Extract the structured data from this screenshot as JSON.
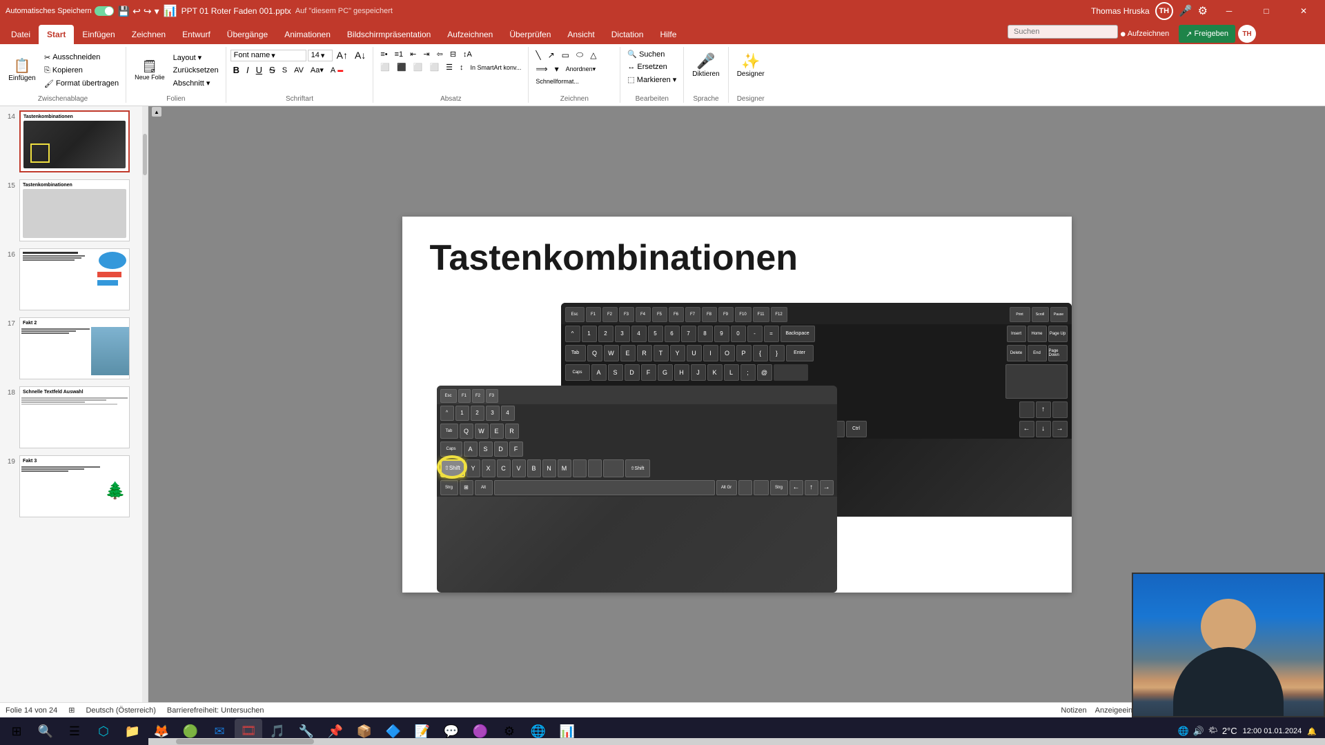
{
  "titlebar": {
    "autosave_label": "Automatisches Speichern",
    "autosave_on": true,
    "filename": "PPT 01 Roter Faden 001.pptx",
    "save_location": "Auf \"diesem PC\" gespeichert",
    "user_name": "Thomas Hruska",
    "user_initials": "TH",
    "minimize_btn": "─",
    "restore_btn": "□",
    "close_btn": "✕"
  },
  "ribbon": {
    "tabs": [
      {
        "label": "Datei",
        "active": false
      },
      {
        "label": "Start",
        "active": true
      },
      {
        "label": "Einfügen",
        "active": false
      },
      {
        "label": "Zeichnen",
        "active": false
      },
      {
        "label": "Entwurf",
        "active": false
      },
      {
        "label": "Übergänge",
        "active": false
      },
      {
        "label": "Animationen",
        "active": false
      },
      {
        "label": "Bildschirmpräsentation",
        "active": false
      },
      {
        "label": "Aufzeichnen",
        "active": false
      },
      {
        "label": "Überprüfen",
        "active": false
      },
      {
        "label": "Ansicht",
        "active": false
      },
      {
        "label": "Dictation",
        "active": false
      },
      {
        "label": "Hilfe",
        "active": false
      }
    ],
    "groups": {
      "zwischenablage": {
        "label": "Zwischenablage",
        "einfuegen": "Einfügen",
        "ausschneiden": "Ausschneiden",
        "kopieren": "Kopieren",
        "format_uebertragen": "Format übertragen"
      },
      "folien": {
        "label": "Folien",
        "neue_folie": "Neue\nFolie",
        "layout": "Layout",
        "zuruecksetzen": "Zurücksetzen",
        "abschnitt": "Abschnitt"
      },
      "schriftart": {
        "label": "Schriftart"
      },
      "absatz": {
        "label": "Absatz"
      },
      "zeichnen": {
        "label": "Zeichnen"
      },
      "bearbeiten": {
        "label": "Bearbeiten",
        "suchen": "Suchen",
        "ersetzen": "Ersetzen",
        "markieren": "Markieren"
      },
      "sprache": {
        "label": "Sprache",
        "diktieren": "Diktieren"
      },
      "designer": {
        "label": "Designer",
        "designer_btn": "Designer"
      }
    },
    "right_buttons": {
      "aufzeichnen": "Aufzeichnen",
      "freigeben": "Freigeben"
    }
  },
  "search": {
    "placeholder": "Suchen"
  },
  "slide_panel": {
    "slides": [
      {
        "num": 14,
        "title": "Tastenkombinationen",
        "active": true,
        "has_keyboard": true,
        "type": "dark_keyboard"
      },
      {
        "num": 15,
        "title": "Tastenkombinationen",
        "active": false,
        "type": "light_keyboard"
      },
      {
        "num": 16,
        "title": "",
        "active": false,
        "type": "content"
      },
      {
        "num": 17,
        "title": "Fakt 2",
        "active": false,
        "type": "person"
      },
      {
        "num": 18,
        "title": "Schnelle Textfeld Auswahl",
        "active": false,
        "type": "text"
      },
      {
        "num": 19,
        "title": "Fakt 3",
        "active": false,
        "type": "tree"
      }
    ]
  },
  "slide": {
    "title": "Tastenkombinationen",
    "num": 14
  },
  "statusbar": {
    "slide_info": "Folie 14 von 24",
    "language": "Deutsch (Österreich)",
    "accessibility": "Barrierefreiheit: Untersuchen",
    "notes": "Notizen",
    "view_settings": "Anzeigeeinstellungen"
  },
  "taskbar": {
    "items": [
      {
        "icon": "⊞",
        "name": "windows-start"
      },
      {
        "icon": "🔍",
        "name": "search"
      },
      {
        "icon": "📋",
        "name": "task-view"
      },
      {
        "icon": "🌐",
        "name": "edge"
      },
      {
        "icon": "📁",
        "name": "explorer"
      },
      {
        "icon": "🦊",
        "name": "firefox"
      },
      {
        "icon": "🔵",
        "name": "chrome"
      },
      {
        "icon": "📧",
        "name": "mail"
      },
      {
        "icon": "🎞️",
        "name": "powerpoint"
      },
      {
        "icon": "🎵",
        "name": "media"
      },
      {
        "icon": "🔧",
        "name": "tool"
      },
      {
        "icon": "📌",
        "name": "pin1"
      },
      {
        "icon": "📦",
        "name": "pkg"
      },
      {
        "icon": "🔷",
        "name": "blue1"
      },
      {
        "icon": "📝",
        "name": "note"
      },
      {
        "icon": "💬",
        "name": "teams"
      },
      {
        "icon": "🟣",
        "name": "purple"
      },
      {
        "icon": "⚙️",
        "name": "settings"
      },
      {
        "icon": "🌐",
        "name": "browser2"
      },
      {
        "icon": "📊",
        "name": "excel"
      }
    ],
    "clock": "2°C",
    "time": "12:00"
  }
}
